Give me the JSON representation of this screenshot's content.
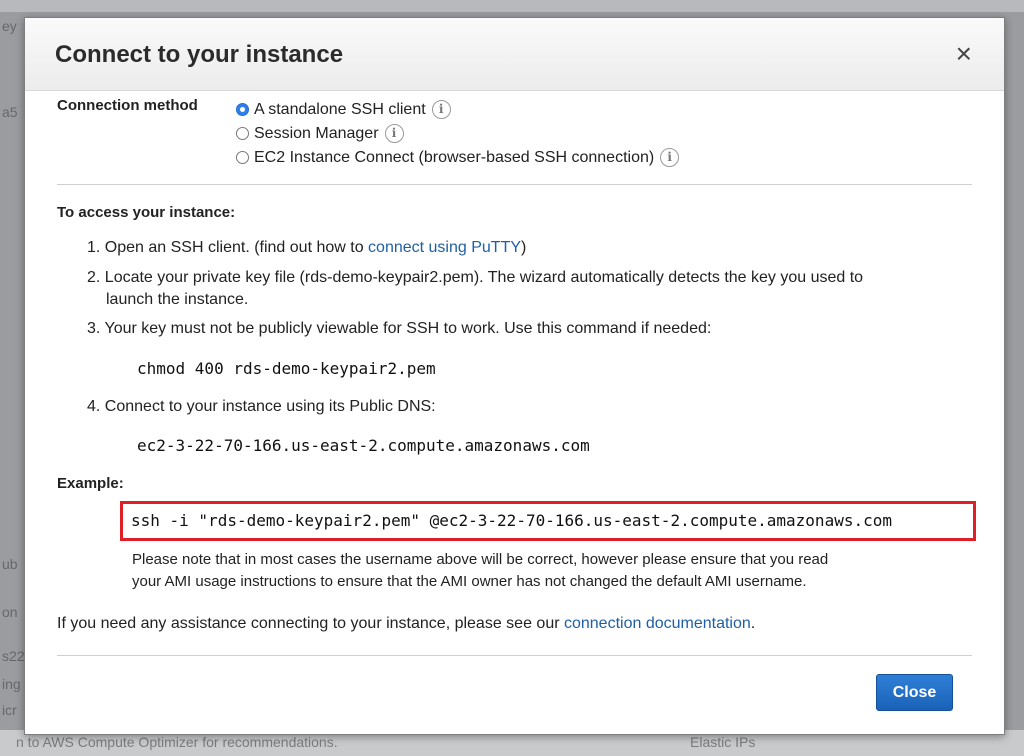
{
  "background": {
    "left_fragments": [
      "ey",
      "a5",
      "ub",
      "on",
      "s22",
      "ing",
      "icr"
    ],
    "bottom_left": "n to AWS Compute Optimizer for recommendations.",
    "bottom_right": "Elastic IPs"
  },
  "modal": {
    "title": "Connect to your instance",
    "close_icon": "×",
    "connection_method": {
      "label": "Connection method",
      "options": [
        {
          "label": "A standalone SSH client",
          "selected": true
        },
        {
          "label": "Session Manager",
          "selected": false
        },
        {
          "label": "EC2 Instance Connect (browser-based SSH connection)",
          "selected": false
        }
      ],
      "info_glyph": "i"
    },
    "access": {
      "heading": "To access your instance:",
      "step1_prefix": "1. Open an SSH client. (find out how to ",
      "step1_link": "connect using PuTTY",
      "step1_suffix": ")",
      "step2_line1": "2. Locate your private key file (rds-demo-keypair2.pem). The wizard automatically detects the key you used to",
      "step2_line2": "launch the instance.",
      "step3": "3. Your key must not be publicly viewable for SSH to work. Use this command if needed:",
      "chmod_cmd": "chmod 400 rds-demo-keypair2.pem",
      "step4": "4. Connect to your instance using its Public DNS:",
      "dns": "ec2-3-22-70-166.us-east-2.compute.amazonaws.com"
    },
    "example": {
      "heading": "Example:",
      "command": "ssh -i \"rds-demo-keypair2.pem\" @ec2-3-22-70-166.us-east-2.compute.amazonaws.com",
      "note_line1": "Please note that in most cases the username above will be correct, however please ensure that you read",
      "note_line2": "your AMI usage instructions to ensure that the AMI owner has not changed the default AMI username."
    },
    "assistance": {
      "prefix": "If you need any assistance connecting to your instance, please see our ",
      "link": "connection documentation",
      "suffix": "."
    },
    "close_button": "Close"
  }
}
